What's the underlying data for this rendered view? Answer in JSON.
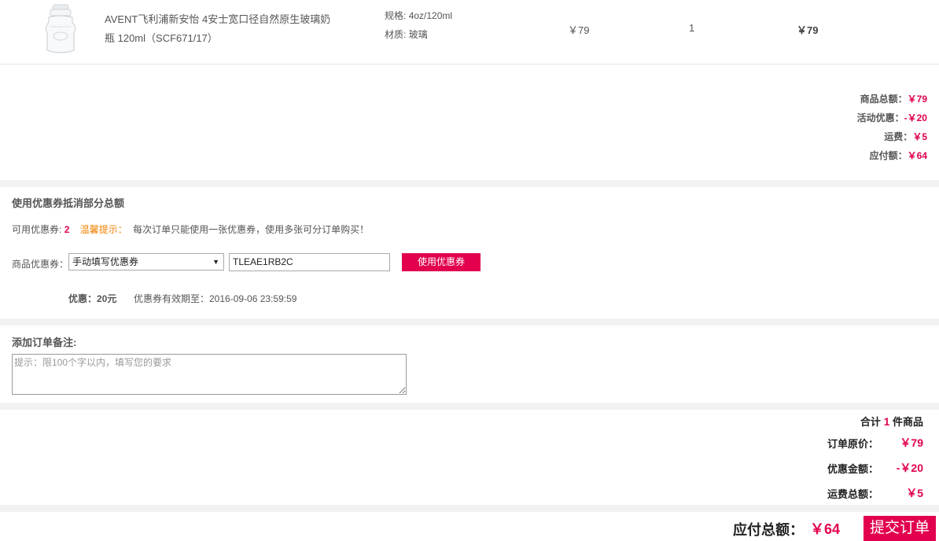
{
  "product": {
    "name": "AVENT飞利浦新安怡 4安士宽口径自然原生玻璃奶瓶 120ml（SCF671/17）",
    "spec_label": "规格:",
    "spec_value": "4oz/120ml",
    "material_label": "材质:",
    "material_value": "玻璃",
    "unit_price": "￥79",
    "quantity": "1",
    "subtotal": "￥79"
  },
  "summary": {
    "goods_total_label": "商品总额：",
    "goods_total_value": "￥79",
    "promo_label": "活动优惠：",
    "promo_value": "-￥20",
    "shipping_label": "运费：",
    "shipping_value": "￥5",
    "payable_label": "应付额：",
    "payable_value": "￥64"
  },
  "coupon": {
    "section_title": "使用优惠券抵消部分总额",
    "available_label": "可用优惠券:",
    "available_count": "2",
    "tip_label": "温馨提示：",
    "tip_text": "每次订单只能使用一张优惠券，使用多张可分订单购买！",
    "select_label": "商品优惠券：",
    "select_value": "手动填写优惠券",
    "code_value": "TLEAE1RB2C",
    "apply_label": "使用优惠券",
    "discount_text": "优惠：20元",
    "expiry_text": "优惠券有效期至：2016-09-06 23:59:59"
  },
  "remark": {
    "title": "添加订单备注:",
    "placeholder": "提示：限100个字以内，填写您的要求"
  },
  "totals": {
    "count_prefix": "合计",
    "count_value": "1",
    "count_suffix": "件商品",
    "original_label": "订单原价：",
    "original_value": "￥79",
    "discount_label": "优惠金额：",
    "discount_value": "-￥20",
    "shipping_label": "运费总额：",
    "shipping_value": "￥5",
    "payable_label": "应付总额：",
    "payable_value": "￥64",
    "submit_label": "提交订单"
  },
  "colors": {
    "accent": "#e2004f",
    "tip": "#f08200",
    "band": "#f2f2f2"
  }
}
